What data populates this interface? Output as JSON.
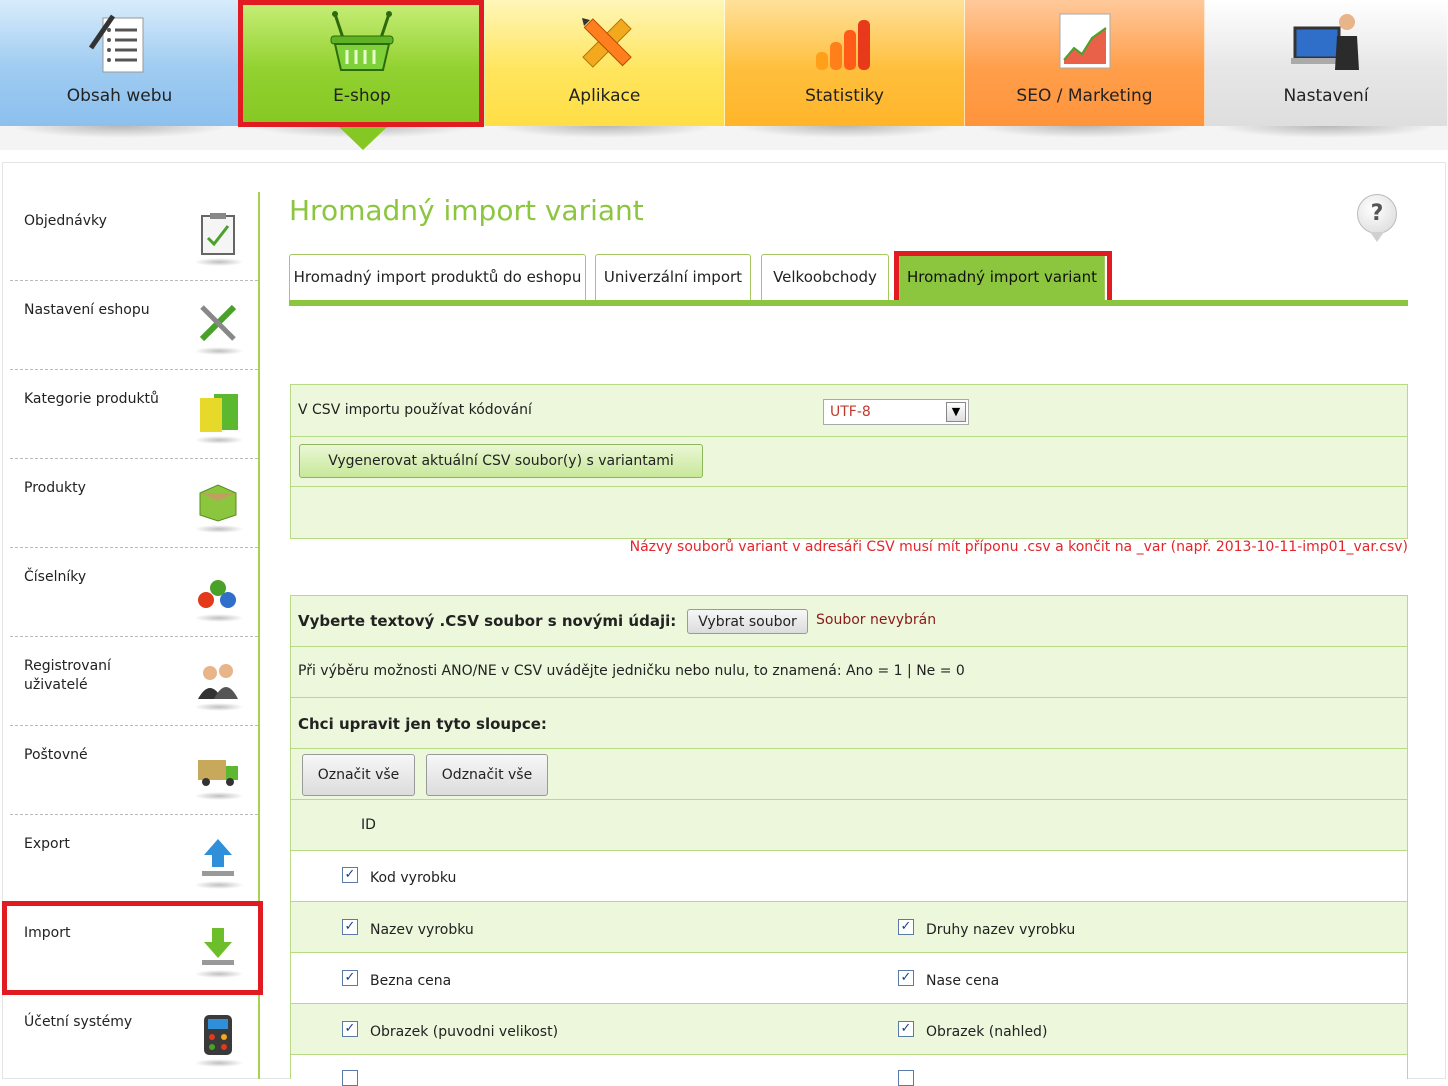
{
  "topnav": {
    "items": [
      {
        "label": "Obsah webu",
        "icon": "document-list-icon"
      },
      {
        "label": "E-shop",
        "icon": "shopping-basket-icon"
      },
      {
        "label": "Aplikace",
        "icon": "pencil-ruler-icon"
      },
      {
        "label": "Statistiky",
        "icon": "bar-chart-icon"
      },
      {
        "label": "SEO / Marketing",
        "icon": "seo-chart-icon"
      },
      {
        "label": "Nastavení",
        "icon": "computer-user-icon"
      }
    ],
    "active": "E-shop"
  },
  "sidebar": {
    "items": [
      {
        "label": "Objednávky",
        "icon": "clipboard-icon"
      },
      {
        "label": "Nastavení eshopu",
        "icon": "tools-icon"
      },
      {
        "label": "Kategorie produktů",
        "icon": "folders-icon"
      },
      {
        "label": "Produkty",
        "icon": "boxes-icon"
      },
      {
        "label": "Číselníky",
        "icon": "numbers-icon"
      },
      {
        "label": "Registrovaní uživatelé",
        "icon": "users-icon"
      },
      {
        "label": "Poštovné",
        "icon": "truck-icon"
      },
      {
        "label": "Export",
        "icon": "upload-icon"
      },
      {
        "label": "Import",
        "icon": "download-icon"
      },
      {
        "label": "Účetní systémy",
        "icon": "calculator-icon"
      }
    ],
    "active": "Import"
  },
  "main": {
    "title": "Hromadný import variant",
    "help": "?",
    "tabs": [
      {
        "label": "Hromadný import produktů do eshopu"
      },
      {
        "label": "Univerzální import"
      },
      {
        "label": "Velkoobchody"
      },
      {
        "label": "Hromadný import variant"
      }
    ],
    "encoding_label": "V CSV importu používat kódování",
    "encoding_value": "UTF-8",
    "generate_button": "Vygenerovat aktuální CSV soubor(y) s variantami",
    "notice": "Názvy souborů variant v adresáři CSV musí mít příponu .csv a končit na _var (např. 2013-10-11-imp01_var.csv)",
    "file_label": "Vyberte textový .CSV soubor s novými údaji:",
    "file_button": "Vybrat soubor",
    "file_status": "Soubor nevybrán",
    "yesno_hint": "Při výběru možnosti ANO/NE v CSV uvádějte jedničku nebo nulu, to znamená: Ano = 1 | Ne = 0",
    "columns_label": "Chci upravit jen tyto sloupce:",
    "select_all": "Označit vše",
    "deselect_all": "Odznačit vše",
    "id_label": "ID",
    "columns": {
      "kod": "Kod vyrobku",
      "nazev": "Nazev vyrobku",
      "druhy_nazev": "Druhy nazev vyrobku",
      "bezna_cena": "Bezna cena",
      "nase_cena": "Nase cena",
      "obrazek_puvodni": "Obrazek (puvodni velikost)",
      "obrazek_nahled": "Obrazek (nahled)"
    },
    "checkmark": "✓"
  },
  "colors": {
    "accent": "#8cc63f",
    "highlight": "#e11b22",
    "notice": "#e2262b"
  }
}
